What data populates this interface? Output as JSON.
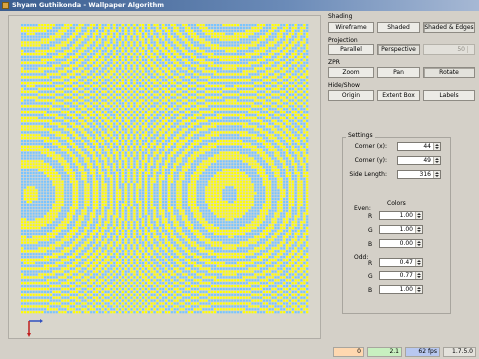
{
  "window": {
    "title": "Shyam Guthikonda - Wallpaper Algorithm"
  },
  "colors": {
    "even": "#ffff00",
    "odd": "#78c4ff",
    "background": "#d9d6cc"
  },
  "panel": {
    "shading": {
      "label": "Shading",
      "wireframe": "Wireframe",
      "shaded": "Shaded",
      "shaded_edges": "Shaded & Edges"
    },
    "projection": {
      "label": "Projection",
      "parallel": "Parallel",
      "perspective": "Perspective",
      "fov_value": "50"
    },
    "zpr": {
      "label": "ZPR",
      "zoom": "Zoom",
      "pan": "Pan",
      "rotate": "Rotate"
    },
    "hide_show": {
      "label": "Hide/Show",
      "origin": "Origin",
      "extent_box": "Extent Box",
      "labels": "Labels"
    },
    "settings": {
      "title": "Settings",
      "corner_x_label": "Corner (x):",
      "corner_x": "44",
      "corner_y_label": "Corner (y):",
      "corner_y": "49",
      "side_length_label": "Side Length:",
      "side_length": "316",
      "colors_title": "Colors",
      "even_label": "Even:",
      "even_r_label": "R",
      "even_r": "1.00",
      "even_g_label": "G",
      "even_g": "1.00",
      "even_b_label": "B",
      "even_b": "0.00",
      "odd_label": "Odd:",
      "odd_r_label": "R",
      "odd_r": "0.47",
      "odd_g_label": "G",
      "odd_g": "0.77",
      "odd_b_label": "B",
      "odd_b": "1.00"
    }
  },
  "status": {
    "field1": "0",
    "field2": "2.1",
    "fps": "62 fps",
    "version": "1.7.5.0"
  }
}
